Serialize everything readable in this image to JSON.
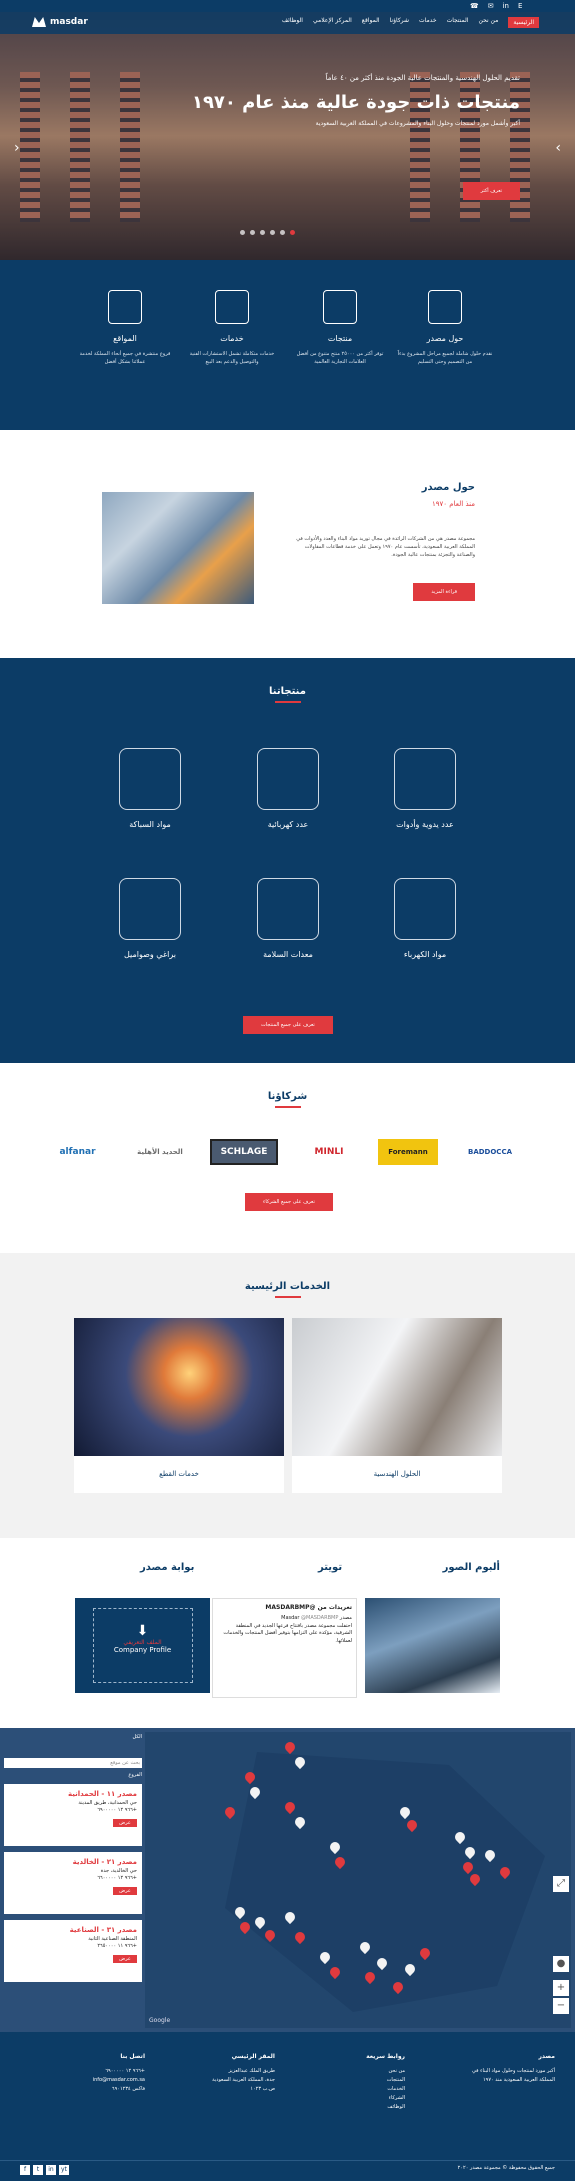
{
  "header": {
    "logo_text": "masdar",
    "lang_switch": "E",
    "top_icons": [
      "phone-icon",
      "mail-icon",
      "linkedin-icon",
      "english-toggle"
    ],
    "nav": [
      "الرئيسية",
      "من نحن",
      "المنتجات",
      "خدمات",
      "شركاؤنا",
      "المواقع",
      "المركز الإعلامي",
      "الوظائف"
    ]
  },
  "hero": {
    "subtitle": "تقديم الحلول الهندسية والمنتجات عالية الجودة منذ أكثر من ٤٠ عاماً",
    "title": "منتجات ذات جودة عالية منذ عام ١٩٧٠",
    "description": "أكبر وأشمل مورد لمنتجات وحلول البناء والمشروعات في المملكة العربية السعودية",
    "cta": "تعرف أكثر"
  },
  "features": [
    {
      "title": "حول مصدر",
      "text": "نقدم حلول شاملة لجميع مراحل المشروع بدءاً من التصميم وحتى التسليم"
    },
    {
      "title": "منتجات",
      "text": "توفر أكثر من ٢٥٠٠٠ منتج متنوع من أفضل العلامات التجارية العالمية"
    },
    {
      "title": "خدمات",
      "text": "خدمات متكاملة تشمل الاستشارات الفنية والتوصيل والدعم بعد البيع"
    },
    {
      "title": "المواقع",
      "text": "فروع منتشرة في جميع أنحاء المملكة لخدمة عملائنا بشكل أفضل"
    }
  ],
  "about": {
    "title": "حول مصدر",
    "since": "منذ العام ١٩٧٠",
    "text": "مجموعة مصدر هي من الشركات الرائدة في مجال توريد مواد البناء والعدد والأدوات في المملكة العربية السعودية، تأسست عام ١٩٧٠ وتعمل على خدمة قطاعات المقاولات والصناعة والتجزئة بمنتجات عالية الجودة.",
    "button": "قراءة المزيد"
  },
  "products": {
    "title": "منتجاتنا",
    "items": [
      "عدد يدوية وأدوات",
      "عدد كهربائية",
      "مواد السباكة",
      "مواد الكهرباء",
      "معدات السلامة",
      "براغي وصواميل"
    ],
    "button": "تعرف على جميع المنتجات"
  },
  "partners": {
    "title": "شركاؤنا",
    "logos": [
      "alfanar",
      "الحديد الأهلية",
      "SCHLAGE",
      "MINLI",
      "Foremann",
      "BADDOCCA"
    ],
    "button": "تعرف على جميع الشركاء"
  },
  "services": {
    "title": "الخدمات الرئيسية",
    "items": [
      "الحلول الهندسية",
      "خدمات القطع"
    ]
  },
  "media": {
    "photos_title": "ألبوم الصور",
    "twitter_title": "تويتر",
    "portal_title": "بوابة مصدر",
    "tweet_header": "تغريدات من @MASDARBMP",
    "tweet_author": "مصدر Masdar",
    "tweet_handle": "@MASDARBMP",
    "tweet_text": "احتفلت مجموعة مصدر بافتتاح فرعها الجديد في المنطقة الشرقية، مؤكدة على التزامها بتوفير أفضل المنتجات والخدمات لعملائها.",
    "profile_label": "الملف التعريفي",
    "profile_en": "Company Profile"
  },
  "map": {
    "search_placeholder": "بحث عن موقع",
    "all_option": "الكل",
    "branches_title": "الفروع",
    "branches": [
      {
        "name": "مصدر ١١ - الحمدانية",
        "address": "حي الحمدانية، طريق المدينة",
        "phone": "+٩٦٦ ١٢ ٦٩٠٠٠٠٠",
        "button": "عرض"
      },
      {
        "name": "مصدر ٢١ - الخالدية",
        "address": "حي الخالدية، جدة",
        "phone": "+٩٦٦ ١٢ ٦٦٠٠٠٠٠",
        "button": "عرض"
      },
      {
        "name": "مصدر ٣١ - الصناعية",
        "address": "المنطقة الصناعية الثانية",
        "phone": "+٩٦٦ ١١ ٢٦٥٠٠٠٠",
        "button": "عرض"
      }
    ],
    "google_label": "Google"
  },
  "footer": {
    "about_title": "مصدر",
    "about_text": "أكبر مورد لمنتجات وحلول مواد البناء في المملكة العربية السعودية منذ ١٩٧٠",
    "links_title": "روابط سريعة",
    "links": [
      "من نحن",
      "المنتجات",
      "الخدمات",
      "الشركاء",
      "الوظائف"
    ],
    "hq_title": "المقر الرئيسي",
    "hq_lines": [
      "طريق الملك عبدالعزيز",
      "جدة، المملكة العربية السعودية",
      "ص.ب ١٠٢٣"
    ],
    "contact_title": "اتصل بنا",
    "contact_lines": [
      "+٩٦٦ ١٢ ٦٩٠٠٠٠٠",
      "info@masdar.com.sa",
      "فاكس ٦٩٠١٢٣٤"
    ],
    "copyright": "جميع الحقوق محفوظة © مجموعة مصدر ٢٠٢٠",
    "social": [
      "f",
      "t",
      "in",
      "yt"
    ]
  },
  "colors": {
    "navy": "#0c3c66",
    "accent": "#e03a3e"
  }
}
